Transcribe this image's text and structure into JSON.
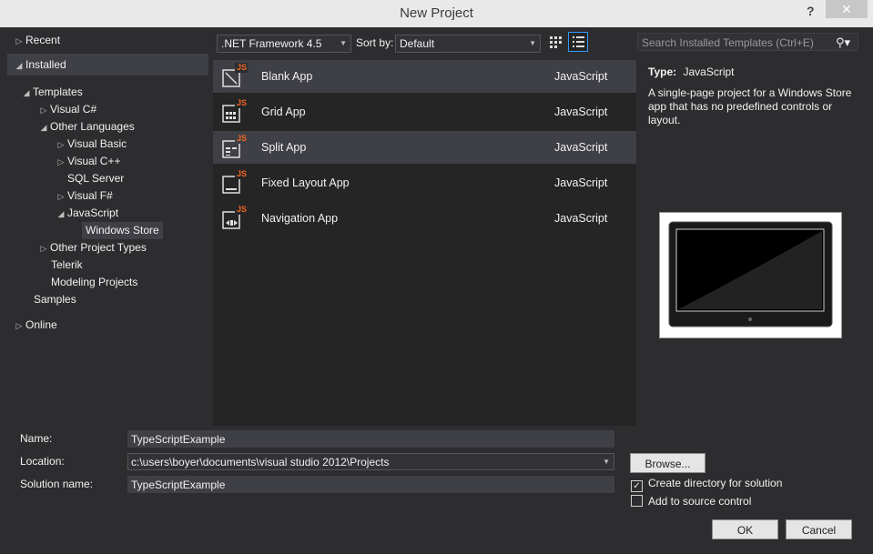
{
  "window": {
    "title": "New Project",
    "help": "?",
    "close": "✕"
  },
  "tree": {
    "recent": "Recent",
    "installed": "Installed",
    "templates": "Templates",
    "visual_csharp": "Visual C#",
    "other_languages": "Other Languages",
    "visual_basic": "Visual Basic",
    "visual_cpp": "Visual C++",
    "sql_server": "SQL Server",
    "visual_fsharp": "Visual F#",
    "javascript": "JavaScript",
    "windows_store": "Windows Store",
    "other_project_types": "Other Project Types",
    "telerik": "Telerik",
    "modeling_projects": "Modeling Projects",
    "samples": "Samples",
    "online": "Online"
  },
  "toolbar": {
    "framework": ".NET Framework 4.5",
    "sort_label": "Sort by:",
    "sort_value": "Default"
  },
  "templates": [
    {
      "name": "Blank App",
      "lang": "JavaScript",
      "icon": "blank-app-icon"
    },
    {
      "name": "Grid App",
      "lang": "JavaScript",
      "icon": "grid-app-icon"
    },
    {
      "name": "Split App",
      "lang": "JavaScript",
      "icon": "split-app-icon"
    },
    {
      "name": "Fixed Layout App",
      "lang": "JavaScript",
      "icon": "fixed-layout-app-icon"
    },
    {
      "name": "Navigation App",
      "lang": "JavaScript",
      "icon": "navigation-app-icon"
    }
  ],
  "icon_badge": "JS",
  "search": {
    "placeholder": "Search Installed Templates (Ctrl+E)"
  },
  "detail": {
    "type_label": "Type:",
    "type_value": "JavaScript",
    "description": "A single-page project for a Windows Store app that has no predefined controls or layout."
  },
  "form": {
    "name_label": "Name:",
    "name_value": "TypeScriptExample",
    "location_label": "Location:",
    "location_value": "c:\\users\\boyer\\documents\\visual studio 2012\\Projects",
    "solution_label": "Solution name:",
    "solution_value": "TypeScriptExample",
    "browse": "Browse...",
    "create_dir": "Create directory for solution",
    "add_source": "Add to source control",
    "ok": "OK",
    "cancel": "Cancel"
  },
  "colors": {
    "background": "#2d2d30",
    "list_bg": "#252526",
    "selection": "#3f3f46",
    "accent": "#3399ff",
    "js_badge": "#f26522"
  }
}
